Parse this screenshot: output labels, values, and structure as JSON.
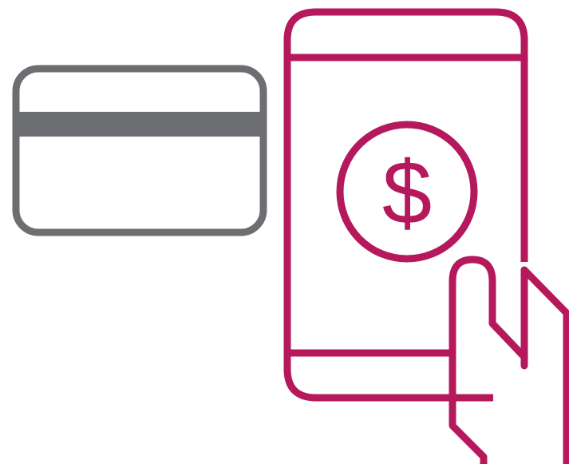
{
  "illustration": {
    "colors": {
      "card_stroke": "#6d6e71",
      "accent": "#b5195b",
      "background": "#ffffff"
    },
    "credit_card": {
      "icon": "credit-card-icon"
    },
    "smartphone": {
      "icon": "smartphone-icon",
      "currency_symbol": "$"
    },
    "hand": {
      "icon": "hand-icon"
    }
  }
}
